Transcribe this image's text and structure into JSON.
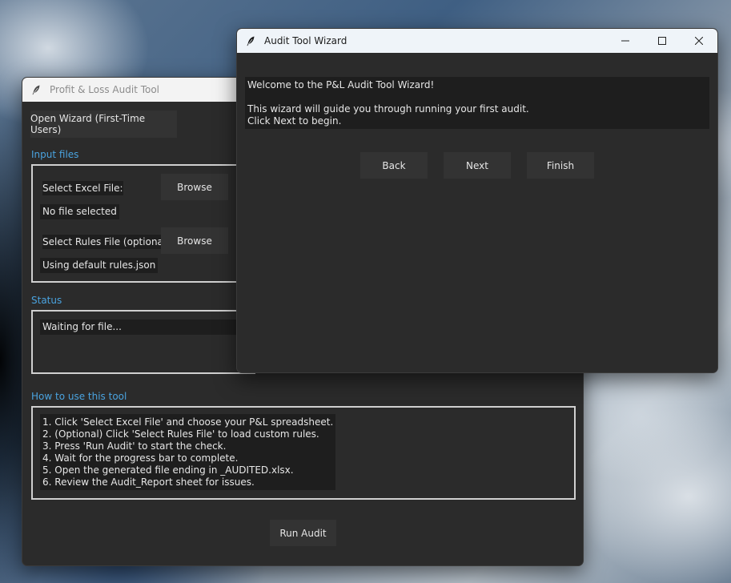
{
  "main": {
    "title": "Profit & Loss Audit Tool",
    "open_wizard_label": "Open Wizard (First-Time Users)",
    "input_files_label": "Input files",
    "select_excel_label": "Select Excel File:",
    "browse_label": "Browse",
    "excel_status": "No file selected",
    "select_rules_label": "Select Rules File (optional):",
    "rules_status": "Using default rules.json",
    "status_section_label": "Status",
    "status_text": "Waiting for file...",
    "howto_label": "How to use this tool",
    "howto_lines": [
      "1. Click 'Select Excel File' and choose your P&L spreadsheet.",
      "2. (Optional) Click 'Select Rules File' to load custom rules.",
      "3. Press 'Run Audit' to start the check.",
      "4. Wait for the progress bar to complete.",
      "5. Open the generated file ending in _AUDITED.xlsx.",
      "6. Review the Audit_Report sheet for issues."
    ],
    "run_audit_label": "Run Audit"
  },
  "wizard": {
    "title": "Audit Tool Wizard",
    "welcome_lines": [
      "Welcome to the P&L Audit Tool Wizard!",
      "",
      "This wizard will guide you through running your first audit.",
      "Click Next to begin."
    ],
    "back_label": "Back",
    "next_label": "Next",
    "finish_label": "Finish"
  }
}
